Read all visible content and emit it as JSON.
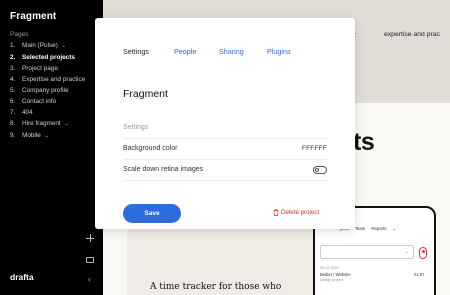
{
  "sidebar": {
    "title": "Fragment",
    "section_label": "Pages",
    "pages": [
      {
        "num": "1.",
        "label": "Main (Pulse)",
        "chevron": "⌄",
        "active": false
      },
      {
        "num": "2.",
        "label": "Selected projects",
        "chevron": "",
        "active": true
      },
      {
        "num": "3.",
        "label": "Project page",
        "chevron": "",
        "active": false
      },
      {
        "num": "4.",
        "label": "Expertise and practice",
        "chevron": "",
        "active": false
      },
      {
        "num": "5.",
        "label": "Company profile",
        "chevron": "",
        "active": false
      },
      {
        "num": "6.",
        "label": "Contact info",
        "chevron": "",
        "active": false
      },
      {
        "num": "7.",
        "label": "404",
        "chevron": "",
        "active": false
      },
      {
        "num": "8.",
        "label": "Hire fragment",
        "chevron": "⌄",
        "active": false
      },
      {
        "num": "9.",
        "label": "Mobile",
        "chevron": "⌄",
        "active": false
      }
    ],
    "logo": "drafta",
    "icons": [
      "plus-icon",
      "folder-icon",
      "back-arrow-icon"
    ]
  },
  "preview": {
    "nav_link": "expertise and prac",
    "headline": "ts",
    "tagline": "A time tracker for those who",
    "phone": {
      "nav": [
        "jects",
        "Team",
        "Reports",
        "⌄"
      ],
      "date": "09.12.2020",
      "entry": "Beiber / Website",
      "time": "01:07",
      "sub": "Design project"
    }
  },
  "modal": {
    "tabs": [
      "Settings",
      "People",
      "Sharing",
      "Plugins"
    ],
    "title": "Fragment",
    "section_header": "Settings",
    "background_label": "Background color",
    "background_value": "FFFFFF",
    "retina_label": "Scale down retina images",
    "retina_enabled": false,
    "save_label": "Save",
    "delete_label": "Delete project"
  },
  "colors": {
    "accent": "#2f6ce0",
    "danger": "#d9302c",
    "sidebar_bg": "#000000",
    "preview_bg": "#e0ddd6"
  }
}
